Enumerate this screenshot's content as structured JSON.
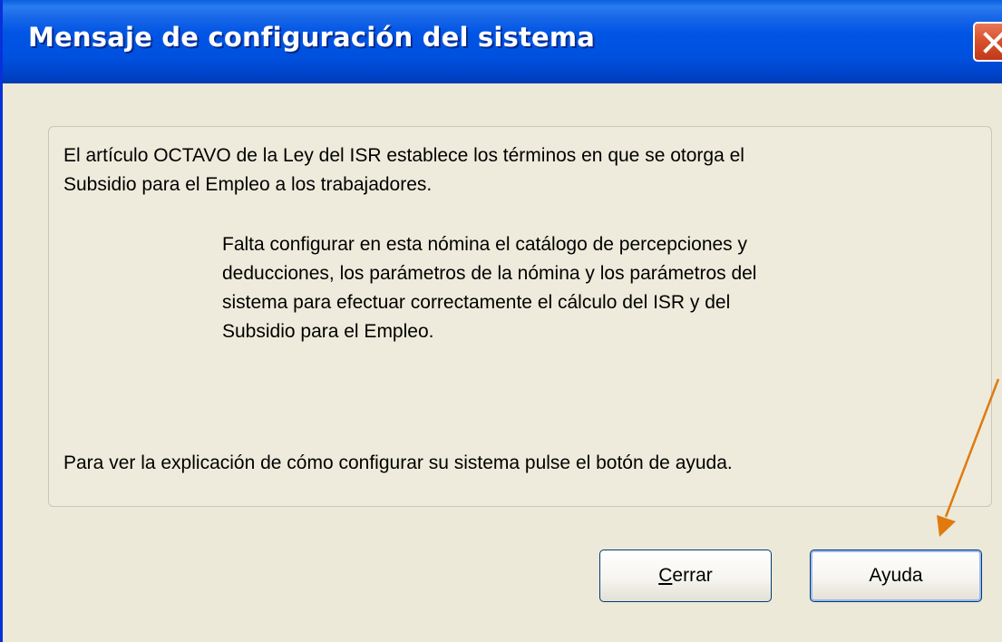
{
  "window": {
    "title": "Mensaje de configuración del sistema"
  },
  "message": {
    "paragraph1": "El artículo OCTAVO de la Ley del ISR establece los términos en que se otorga el\nSubsidio para el Empleo a los trabajadores.",
    "paragraph2": "Falta configurar en esta nómina el catálogo de percepciones y\ndeducciones, los parámetros de la nómina y los parámetros del\nsistema para efectuar correctamente el cálculo del ISR y del\nSubsidio para el Empleo.",
    "paragraph3": "Para ver la explicación de cómo configurar su sistema pulse el botón de ayuda."
  },
  "buttons": {
    "close_first_letter": "C",
    "close_rest": "errar",
    "help": "Ayuda"
  },
  "colors": {
    "titlebar": "#0055e5",
    "close_button": "#d9532c",
    "dialog_background": "#ece9d8",
    "annotation_arrow": "#e07a10"
  },
  "icons": {
    "close": "close-x-icon",
    "annotation": "arrow-annotation"
  }
}
